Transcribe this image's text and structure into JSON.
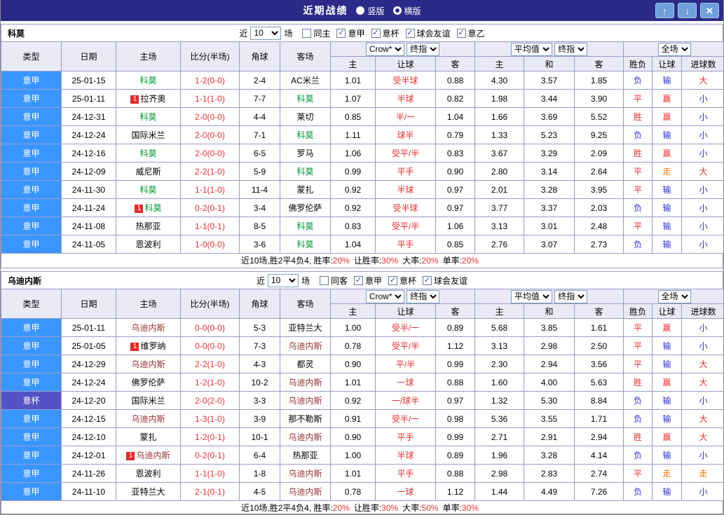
{
  "colors": {
    "titlebar": "#2B2B87",
    "border": "#9A9ACC",
    "header_bg": "#EAEAF6",
    "league_blue": "#3A96FF",
    "league_purple": "#5552C6",
    "red": "#E53333",
    "blue": "#2B32CC",
    "orange": "#FF7700",
    "green": "#009933",
    "maroon": "#993333",
    "button_bg": "#6FA0D8"
  },
  "titlebar": {
    "title": "近期战绩",
    "radios": [
      {
        "label": "竖版",
        "checked": false
      },
      {
        "label": "横版",
        "checked": true
      }
    ],
    "buttons": {
      "up": "scroll-up",
      "down": "scroll-down",
      "close": "close"
    }
  },
  "labels": {
    "near": "近",
    "games_suffix": "场"
  },
  "columns": {
    "main": [
      "类型",
      "日期",
      "主场",
      "比分(半场)",
      "角球",
      "客场"
    ],
    "odds_sub": [
      "主",
      "让球",
      "客"
    ],
    "avg_sub": [
      "主",
      "和",
      "客"
    ],
    "full_sub": [
      "胜负",
      "让球",
      "进球数"
    ]
  },
  "selects": {
    "odds_source": "Crow*",
    "odds_kind": "终指",
    "average": "平均值",
    "avg_kind": "终指",
    "scope": "全场"
  },
  "sections": [
    {
      "team": "科莫",
      "team_color": "green",
      "filter": {
        "games_value": "10",
        "checkboxes": [
          {
            "label": "同主",
            "checked": false
          },
          {
            "label": "意甲",
            "checked": true
          },
          {
            "label": "意杯",
            "checked": true
          },
          {
            "label": "球会友谊",
            "checked": true
          },
          {
            "label": "意乙",
            "checked": true
          }
        ]
      },
      "rows": [
        {
          "league": "意甲",
          "league_style": "lg-blue",
          "date": "25-01-15",
          "home": "科莫",
          "home_c": "team",
          "home_badge": false,
          "score": "1-2(0-0)",
          "corners": "2-4",
          "away": "AC米兰",
          "away_c": "plain",
          "away_badge": false,
          "odds": [
            "1.01",
            "受半球",
            "0.88"
          ],
          "avg": [
            "4.30",
            "3.57",
            "1.85"
          ],
          "result": {
            "t": "负",
            "c": "blue"
          },
          "handicap_result": {
            "t": "输",
            "c": "blue"
          },
          "goals": {
            "t": "大",
            "c": "red"
          }
        },
        {
          "league": "意甲",
          "league_style": "lg-blue",
          "date": "25-01-11",
          "home": "拉齐奥",
          "home_c": "plain",
          "home_badge": true,
          "score": "1-1(1-0)",
          "corners": "7-7",
          "away": "科莫",
          "away_c": "team",
          "away_badge": false,
          "odds": [
            "1.07",
            "半球",
            "0.82"
          ],
          "avg": [
            "1.98",
            "3.44",
            "3.90"
          ],
          "result": {
            "t": "平",
            "c": "red"
          },
          "handicap_result": {
            "t": "赢",
            "c": "red"
          },
          "goals": {
            "t": "小",
            "c": "blue"
          }
        },
        {
          "league": "意甲",
          "league_style": "lg-blue",
          "date": "24-12-31",
          "home": "科莫",
          "home_c": "team",
          "home_badge": false,
          "score": "2-0(0-0)",
          "corners": "4-4",
          "away": "莱切",
          "away_c": "plain",
          "away_badge": false,
          "odds": [
            "0.85",
            "半/一",
            "1.04"
          ],
          "avg": [
            "1.66",
            "3.69",
            "5.52"
          ],
          "result": {
            "t": "胜",
            "c": "red"
          },
          "handicap_result": {
            "t": "赢",
            "c": "red"
          },
          "goals": {
            "t": "小",
            "c": "blue"
          }
        },
        {
          "league": "意甲",
          "league_style": "lg-blue",
          "date": "24-12-24",
          "home": "国际米兰",
          "home_c": "plain",
          "home_badge": false,
          "score": "2-0(0-0)",
          "corners": "7-1",
          "away": "科莫",
          "away_c": "team",
          "away_badge": false,
          "odds": [
            "1.11",
            "球半",
            "0.79"
          ],
          "avg": [
            "1.33",
            "5.23",
            "9.25"
          ],
          "result": {
            "t": "负",
            "c": "blue"
          },
          "handicap_result": {
            "t": "输",
            "c": "blue"
          },
          "goals": {
            "t": "小",
            "c": "blue"
          }
        },
        {
          "league": "意甲",
          "league_style": "lg-blue",
          "date": "24-12-16",
          "home": "科莫",
          "home_c": "team",
          "home_badge": false,
          "score": "2-0(0-0)",
          "corners": "6-5",
          "away": "罗马",
          "away_c": "plain",
          "away_badge": false,
          "odds": [
            "1.06",
            "受平/半",
            "0.83"
          ],
          "avg": [
            "3.67",
            "3.29",
            "2.09"
          ],
          "result": {
            "t": "胜",
            "c": "red"
          },
          "handicap_result": {
            "t": "赢",
            "c": "red"
          },
          "goals": {
            "t": "小",
            "c": "blue"
          }
        },
        {
          "league": "意甲",
          "league_style": "lg-blue",
          "date": "24-12-09",
          "home": "威尼斯",
          "home_c": "plain",
          "home_badge": false,
          "score": "2-2(1-0)",
          "corners": "5-9",
          "away": "科莫",
          "away_c": "team",
          "away_badge": false,
          "odds": [
            "0.99",
            "平手",
            "0.90"
          ],
          "avg": [
            "2.80",
            "3.14",
            "2.64"
          ],
          "result": {
            "t": "平",
            "c": "red"
          },
          "handicap_result": {
            "t": "走",
            "c": "orange"
          },
          "goals": {
            "t": "大",
            "c": "red"
          }
        },
        {
          "league": "意甲",
          "league_style": "lg-blue",
          "date": "24-11-30",
          "home": "科莫",
          "home_c": "team",
          "home_badge": false,
          "score": "1-1(1-0)",
          "corners": "11-4",
          "away": "蒙扎",
          "away_c": "plain",
          "away_badge": false,
          "odds": [
            "0.92",
            "半球",
            "0.97"
          ],
          "avg": [
            "2.01",
            "3.28",
            "3.95"
          ],
          "result": {
            "t": "平",
            "c": "red"
          },
          "handicap_result": {
            "t": "输",
            "c": "blue"
          },
          "goals": {
            "t": "小",
            "c": "blue"
          }
        },
        {
          "league": "意甲",
          "league_style": "lg-blue",
          "date": "24-11-24",
          "home": "科莫",
          "home_c": "team",
          "home_badge": true,
          "score": "0-2(0-1)",
          "corners": "3-4",
          "away": "佛罗伦萨",
          "away_c": "plain",
          "away_badge": false,
          "odds": [
            "0.92",
            "受半球",
            "0.97"
          ],
          "avg": [
            "3.77",
            "3.37",
            "2.03"
          ],
          "result": {
            "t": "负",
            "c": "blue"
          },
          "handicap_result": {
            "t": "输",
            "c": "blue"
          },
          "goals": {
            "t": "小",
            "c": "blue"
          }
        },
        {
          "league": "意甲",
          "league_style": "lg-blue",
          "date": "24-11-08",
          "home": "热那亚",
          "home_c": "plain",
          "home_badge": false,
          "score": "1-1(0-1)",
          "corners": "8-5",
          "away": "科莫",
          "away_c": "team",
          "away_badge": false,
          "odds": [
            "0.83",
            "受平/半",
            "1.06"
          ],
          "avg": [
            "3.13",
            "3.01",
            "2.48"
          ],
          "result": {
            "t": "平",
            "c": "red"
          },
          "handicap_result": {
            "t": "输",
            "c": "blue"
          },
          "goals": {
            "t": "小",
            "c": "blue"
          }
        },
        {
          "league": "意甲",
          "league_style": "lg-blue",
          "date": "24-11-05",
          "home": "恩波利",
          "home_c": "plain",
          "home_badge": false,
          "score": "1-0(0-0)",
          "corners": "3-6",
          "away": "科莫",
          "away_c": "team",
          "away_badge": false,
          "odds": [
            "1.04",
            "平手",
            "0.85"
          ],
          "avg": [
            "2.76",
            "3.07",
            "2.73"
          ],
          "result": {
            "t": "负",
            "c": "blue"
          },
          "handicap_result": {
            "t": "输",
            "c": "blue"
          },
          "goals": {
            "t": "小",
            "c": "blue"
          }
        }
      ],
      "summary": {
        "prefix": "近10场,胜2平4负4, ",
        "stats": [
          {
            "label": "胜率:",
            "value": "20%"
          },
          {
            "label": "让胜率:",
            "value": "30%"
          },
          {
            "label": "大率:",
            "value": "20%"
          },
          {
            "label": "单率:",
            "value": "20%"
          }
        ]
      }
    },
    {
      "team": "乌迪内斯",
      "team_color": "maroon",
      "filter": {
        "games_value": "10",
        "checkboxes": [
          {
            "label": "同客",
            "checked": false
          },
          {
            "label": "意甲",
            "checked": true
          },
          {
            "label": "意杯",
            "checked": true
          },
          {
            "label": "球会友谊",
            "checked": true
          }
        ]
      },
      "rows": [
        {
          "league": "意甲",
          "league_style": "lg-blue",
          "date": "25-01-11",
          "home": "乌迪内斯",
          "home_c": "team",
          "home_badge": false,
          "score": "0-0(0-0)",
          "corners": "5-3",
          "away": "亚特兰大",
          "away_c": "plain",
          "away_badge": false,
          "odds": [
            "1.00",
            "受半/一",
            "0.89"
          ],
          "avg": [
            "5.68",
            "3.85",
            "1.61"
          ],
          "result": {
            "t": "平",
            "c": "red"
          },
          "handicap_result": {
            "t": "赢",
            "c": "red"
          },
          "goals": {
            "t": "小",
            "c": "blue"
          }
        },
        {
          "league": "意甲",
          "league_style": "lg-blue",
          "date": "25-01-05",
          "home": "维罗纳",
          "home_c": "plain",
          "home_badge": true,
          "score": "0-0(0-0)",
          "corners": "7-3",
          "away": "乌迪内斯",
          "away_c": "team",
          "away_badge": false,
          "odds": [
            "0.78",
            "受平/半",
            "1.12"
          ],
          "avg": [
            "3.13",
            "2.98",
            "2.50"
          ],
          "result": {
            "t": "平",
            "c": "red"
          },
          "handicap_result": {
            "t": "输",
            "c": "blue"
          },
          "goals": {
            "t": "小",
            "c": "blue"
          }
        },
        {
          "league": "意甲",
          "league_style": "lg-blue",
          "date": "24-12-29",
          "home": "乌迪内斯",
          "home_c": "team",
          "home_badge": false,
          "score": "2-2(1-0)",
          "corners": "4-3",
          "away": "都灵",
          "away_c": "plain",
          "away_badge": false,
          "odds": [
            "0.90",
            "平/半",
            "0.99"
          ],
          "avg": [
            "2.30",
            "2.94",
            "3.56"
          ],
          "result": {
            "t": "平",
            "c": "red"
          },
          "handicap_result": {
            "t": "输",
            "c": "blue"
          },
          "goals": {
            "t": "大",
            "c": "red"
          }
        },
        {
          "league": "意甲",
          "league_style": "lg-blue",
          "date": "24-12-24",
          "home": "佛罗伦萨",
          "home_c": "plain",
          "home_badge": false,
          "score": "1-2(1-0)",
          "corners": "10-2",
          "away": "乌迪内斯",
          "away_c": "team",
          "away_badge": false,
          "odds": [
            "1.01",
            "一球",
            "0.88"
          ],
          "avg": [
            "1.60",
            "4.00",
            "5.63"
          ],
          "result": {
            "t": "胜",
            "c": "red"
          },
          "handicap_result": {
            "t": "赢",
            "c": "red"
          },
          "goals": {
            "t": "大",
            "c": "red"
          }
        },
        {
          "league": "意杯",
          "league_style": "lg-purple",
          "date": "24-12-20",
          "home": "国际米兰",
          "home_c": "plain",
          "home_badge": false,
          "score": "2-0(2-0)",
          "corners": "3-3",
          "away": "乌迪内斯",
          "away_c": "team",
          "away_badge": false,
          "odds": [
            "0.92",
            "一/球半",
            "0.97"
          ],
          "avg": [
            "1.32",
            "5.30",
            "8.84"
          ],
          "result": {
            "t": "负",
            "c": "blue"
          },
          "handicap_result": {
            "t": "输",
            "c": "blue"
          },
          "goals": {
            "t": "小",
            "c": "blue"
          }
        },
        {
          "league": "意甲",
          "league_style": "lg-blue",
          "date": "24-12-15",
          "home": "乌迪内斯",
          "home_c": "team",
          "home_badge": false,
          "score": "1-3(1-0)",
          "corners": "3-9",
          "away": "那不勒斯",
          "away_c": "plain",
          "away_badge": false,
          "odds": [
            "0.91",
            "受半/一",
            "0.98"
          ],
          "avg": [
            "5.36",
            "3.55",
            "1.71"
          ],
          "result": {
            "t": "负",
            "c": "blue"
          },
          "handicap_result": {
            "t": "输",
            "c": "blue"
          },
          "goals": {
            "t": "大",
            "c": "red"
          }
        },
        {
          "league": "意甲",
          "league_style": "lg-blue",
          "date": "24-12-10",
          "home": "蒙扎",
          "home_c": "plain",
          "home_badge": false,
          "score": "1-2(0-1)",
          "corners": "10-1",
          "away": "乌迪内斯",
          "away_c": "team",
          "away_badge": false,
          "odds": [
            "0.90",
            "平手",
            "0.99"
          ],
          "avg": [
            "2.71",
            "2.91",
            "2.94"
          ],
          "result": {
            "t": "胜",
            "c": "red"
          },
          "handicap_result": {
            "t": "赢",
            "c": "red"
          },
          "goals": {
            "t": "大",
            "c": "red"
          }
        },
        {
          "league": "意甲",
          "league_style": "lg-blue",
          "date": "24-12-01",
          "home": "乌迪内斯",
          "home_c": "team",
          "home_badge": true,
          "score": "0-2(0-1)",
          "corners": "6-4",
          "away": "热那亚",
          "away_c": "plain",
          "away_badge": false,
          "odds": [
            "1.00",
            "半球",
            "0.89"
          ],
          "avg": [
            "1.96",
            "3.28",
            "4.14"
          ],
          "result": {
            "t": "负",
            "c": "blue"
          },
          "handicap_result": {
            "t": "输",
            "c": "blue"
          },
          "goals": {
            "t": "小",
            "c": "blue"
          }
        },
        {
          "league": "意甲",
          "league_style": "lg-blue",
          "date": "24-11-26",
          "home": "恩波利",
          "home_c": "plain",
          "home_badge": false,
          "score": "1-1(1-0)",
          "corners": "1-8",
          "away": "乌迪内斯",
          "away_c": "team",
          "away_badge": false,
          "odds": [
            "1.01",
            "平手",
            "0.88"
          ],
          "avg": [
            "2.98",
            "2.83",
            "2.74"
          ],
          "result": {
            "t": "平",
            "c": "red"
          },
          "handicap_result": {
            "t": "走",
            "c": "orange"
          },
          "goals": {
            "t": "走",
            "c": "orange"
          }
        },
        {
          "league": "意甲",
          "league_style": "lg-blue",
          "date": "24-11-10",
          "home": "亚特兰大",
          "home_c": "plain",
          "home_badge": false,
          "score": "2-1(0-1)",
          "corners": "4-5",
          "away": "乌迪内斯",
          "away_c": "team",
          "away_badge": false,
          "odds": [
            "0.78",
            "一球",
            "1.12"
          ],
          "avg": [
            "1.44",
            "4.49",
            "7.26"
          ],
          "result": {
            "t": "负",
            "c": "blue"
          },
          "handicap_result": {
            "t": "输",
            "c": "blue"
          },
          "goals": {
            "t": "小",
            "c": "blue"
          }
        }
      ],
      "summary": {
        "prefix": "近10场,胜2平4负4, ",
        "stats": [
          {
            "label": "胜率:",
            "value": "20%"
          },
          {
            "label": "让胜率:",
            "value": "30%"
          },
          {
            "label": "大率:",
            "value": "50%"
          },
          {
            "label": "单率:",
            "value": "30%"
          }
        ]
      }
    }
  ]
}
